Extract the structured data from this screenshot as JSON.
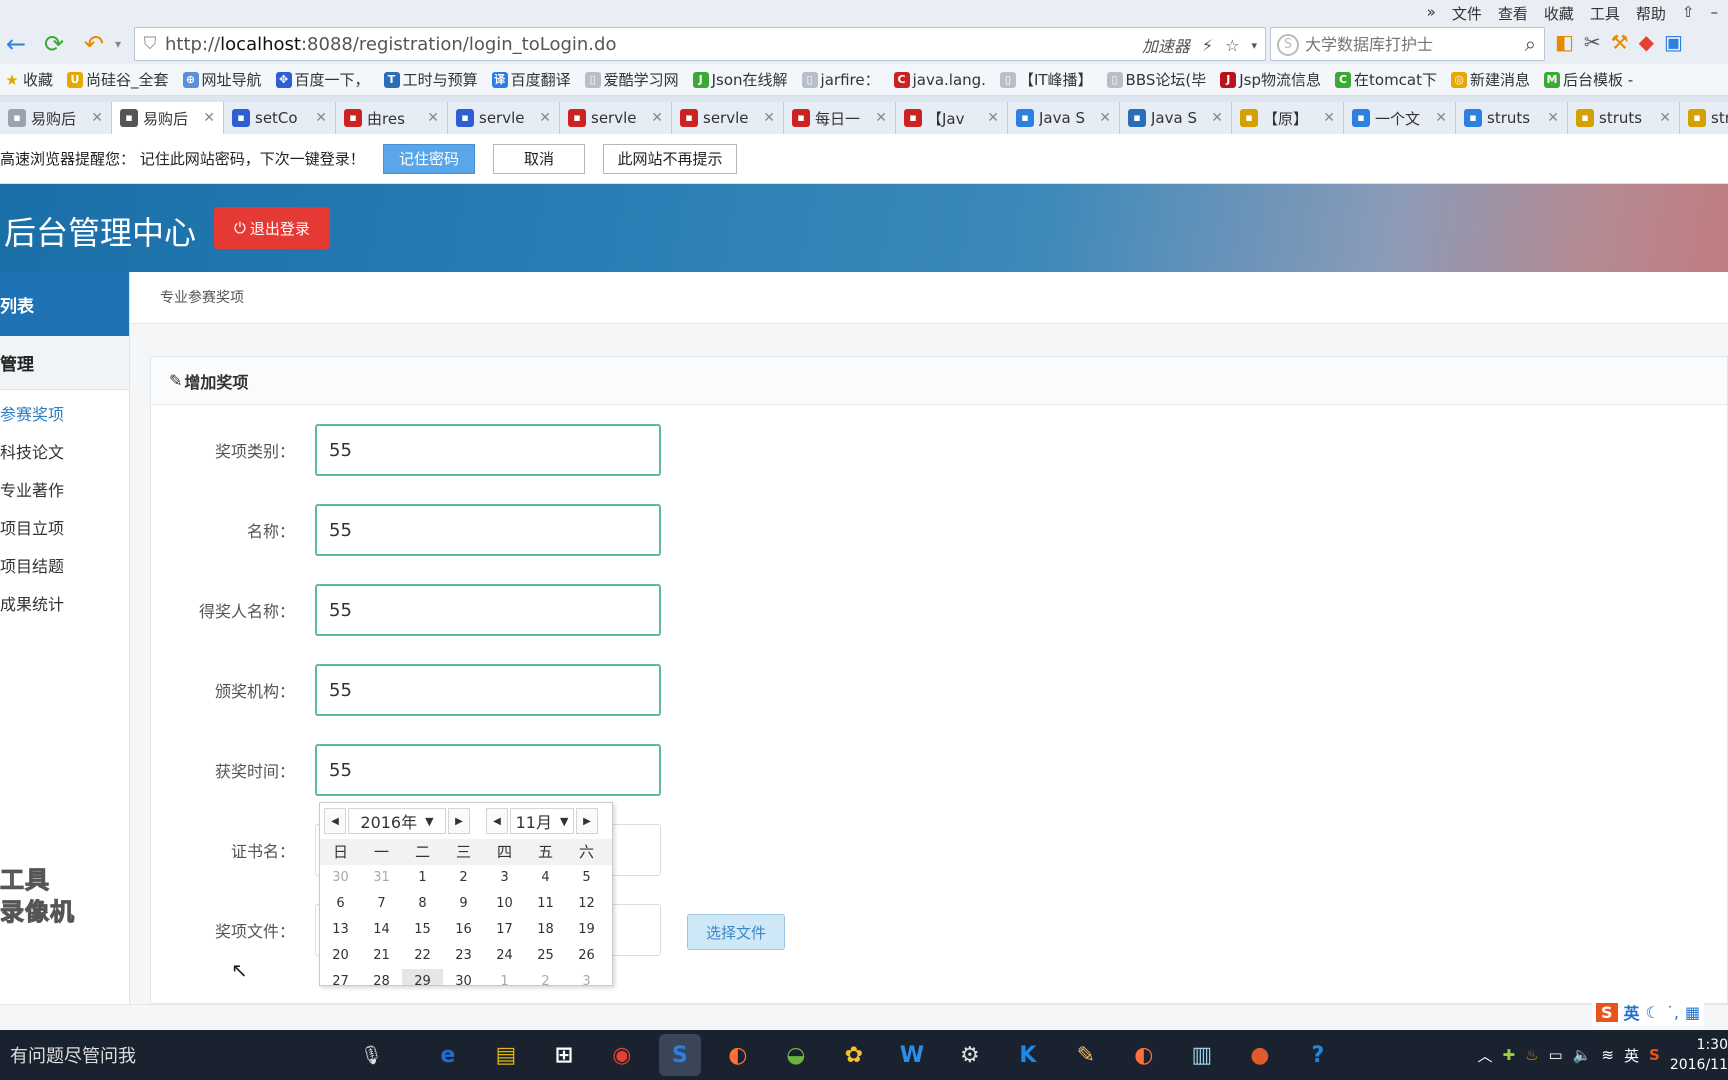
{
  "browser": {
    "menu": [
      "»",
      "文件",
      "查看",
      "收藏",
      "工具",
      "帮助"
    ],
    "address": {
      "url_prefix": "http://",
      "url_host": "localhost",
      "url_rest": ":8088/registration/login_toLogin.do",
      "accelerator": "加速器"
    },
    "search_placeholder": "大学数据库打护士",
    "bookmarks": [
      {
        "label": "收藏",
        "color": "#e6a700"
      },
      {
        "label": "尚硅谷_全套",
        "color": "#e6a700"
      },
      {
        "label": "网址导航",
        "color": "#5b8fd6"
      },
      {
        "label": "百度一下，",
        "color": "#2f5fd0"
      },
      {
        "label": "工时与预算",
        "color": "#2a6db8"
      },
      {
        "label": "百度翻译",
        "color": "#2f7fe0"
      },
      {
        "label": "爱酷学习网",
        "color": "#9aa4b0"
      },
      {
        "label": "Json在线解",
        "color": "#3aaa35"
      },
      {
        "label": "jarfire：",
        "color": "#9aa4b0"
      },
      {
        "label": "java.lang.",
        "color": "#cc2222"
      },
      {
        "label": "【IT峰播】",
        "color": "#9aa4b0"
      },
      {
        "label": "BBS论坛(毕",
        "color": "#9aa4b0"
      },
      {
        "label": "Jsp物流信息",
        "color": "#b8141c"
      },
      {
        "label": "在tomcat下",
        "color": "#3aaa35"
      },
      {
        "label": "新建消息",
        "color": "#e6a700"
      },
      {
        "label": "后台模板 -",
        "color": "#3aaa35"
      }
    ],
    "tabs": [
      {
        "label": "易购后",
        "color": "#9aa4b0"
      },
      {
        "label": "易购后",
        "color": "#555555"
      },
      {
        "label": "setCo",
        "color": "#2f5fd0"
      },
      {
        "label": "由res",
        "color": "#cc2222"
      },
      {
        "label": "servle",
        "color": "#2f5fd0"
      },
      {
        "label": "servle",
        "color": "#cc2222"
      },
      {
        "label": "servle",
        "color": "#cc2222"
      },
      {
        "label": "每日一",
        "color": "#cc2222"
      },
      {
        "label": "【Jav",
        "color": "#cc2222"
      },
      {
        "label": "Java S",
        "color": "#2f7fe0"
      },
      {
        "label": "Java S",
        "color": "#2a6db8"
      },
      {
        "label": "【原】",
        "color": "#d6a000"
      },
      {
        "label": "一个文",
        "color": "#2f7fe0"
      },
      {
        "label": "struts",
        "color": "#2f7fe0"
      },
      {
        "label": "struts",
        "color": "#d6a000"
      },
      {
        "label": "struts",
        "color": "#d6a000"
      }
    ],
    "password_bar": {
      "message": "高速浏览器提醒您： 记住此网站密码，下次一键登录！",
      "remember": "记住密码",
      "cancel": "取消",
      "never": "此网站不再提示"
    }
  },
  "app": {
    "title": "后台管理中心",
    "logout": "退出登录",
    "sidebar": {
      "section1": "列表",
      "section2": "管理",
      "items": [
        "参赛奖项",
        "科技论文",
        "专业著作",
        "项目立项",
        "项目结题",
        "成果统计"
      ]
    },
    "watermark": [
      "工具",
      "录像机"
    ],
    "breadcrumb": "专业参赛奖项",
    "panel_title": "增加奖项",
    "form": {
      "award_type": {
        "label": "奖项类别：",
        "value": "55"
      },
      "name": {
        "label": "名称：",
        "value": "55"
      },
      "winner": {
        "label": "得奖人名称：",
        "value": "55"
      },
      "org": {
        "label": "颁奖机构：",
        "value": "55"
      },
      "date": {
        "label": "获奖时间：",
        "value": "55"
      },
      "cert": {
        "label": "证书名：",
        "value": ""
      },
      "file": {
        "label": "奖项文件：",
        "value": "",
        "button": "选择文件"
      }
    },
    "datepicker": {
      "year": "2016年",
      "month": "11月",
      "weekdays": [
        "日",
        "一",
        "二",
        "三",
        "四",
        "五",
        "六"
      ],
      "weeks": [
        [
          "30",
          "31",
          "1",
          "2",
          "3",
          "4",
          "5"
        ],
        [
          "6",
          "7",
          "8",
          "9",
          "10",
          "11",
          "12"
        ],
        [
          "13",
          "14",
          "15",
          "16",
          "17",
          "18",
          "19"
        ],
        [
          "20",
          "21",
          "22",
          "23",
          "24",
          "25",
          "26"
        ],
        [
          "27",
          "28",
          "29",
          "30",
          "1",
          "2",
          "3"
        ]
      ],
      "today": "29"
    }
  },
  "ime": {
    "lang": "英"
  },
  "taskbar": {
    "search": "有问题尽管问我",
    "apps": [
      {
        "name": "edge",
        "glyph": "e",
        "color": "#1e6fd0"
      },
      {
        "name": "explorer",
        "glyph": "▤",
        "color": "#e6b800"
      },
      {
        "name": "store",
        "glyph": "⊞",
        "color": "#ffffff"
      },
      {
        "name": "chrome",
        "glyph": "◉",
        "color": "#e34133"
      },
      {
        "name": "sogou-browser",
        "glyph": "S",
        "color": "#2f7fe0"
      },
      {
        "name": "firefox",
        "glyph": "◐",
        "color": "#ff7139"
      },
      {
        "name": "spring-tool",
        "glyph": "◒",
        "color": "#6db33f"
      },
      {
        "name": "app-yellow",
        "glyph": "✿",
        "color": "#f2c230"
      },
      {
        "name": "word-app",
        "glyph": "W",
        "color": "#2b8ee8"
      },
      {
        "name": "settings-app",
        "glyph": "⚙",
        "color": "#dddddd"
      },
      {
        "name": "k-app",
        "glyph": "K",
        "color": "#1e88e5"
      },
      {
        "name": "notes-app",
        "glyph": "✎",
        "color": "#f0c060"
      },
      {
        "name": "firefox-2",
        "glyph": "◐",
        "color": "#ff7139"
      },
      {
        "name": "notepad-app",
        "glyph": "▥",
        "color": "#9ccfe8"
      },
      {
        "name": "recorder-app",
        "glyph": "●",
        "color": "#e05a2b"
      },
      {
        "name": "help-app",
        "glyph": "?",
        "color": "#1e88e5"
      }
    ],
    "tray_lang": "英",
    "time": "1:30",
    "date": "2016/11"
  }
}
